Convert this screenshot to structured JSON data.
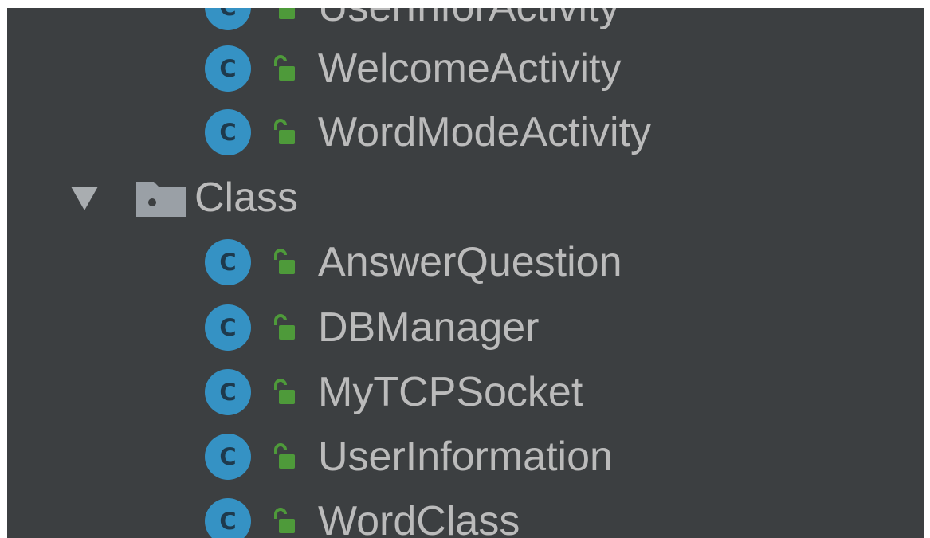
{
  "tree": {
    "top_items": [
      {
        "label": "UserInforActivity",
        "icon": "class-icon",
        "badge": "C",
        "access": "public-lock-icon"
      },
      {
        "label": "WelcomeActivity",
        "icon": "class-icon",
        "badge": "C",
        "access": "public-lock-icon"
      },
      {
        "label": "WordModeActivity",
        "icon": "class-icon",
        "badge": "C",
        "access": "public-lock-icon"
      }
    ],
    "folder": {
      "label": "Class",
      "icon": "package-folder-icon",
      "expanded": true,
      "children": [
        {
          "label": "AnswerQuestion",
          "icon": "class-icon",
          "badge": "C",
          "access": "public-lock-icon"
        },
        {
          "label": "DBManager",
          "icon": "class-icon",
          "badge": "C",
          "access": "public-lock-icon"
        },
        {
          "label": "MyTCPSocket",
          "icon": "class-icon",
          "badge": "C",
          "access": "public-lock-icon"
        },
        {
          "label": "UserInformation",
          "icon": "class-icon",
          "badge": "C",
          "access": "public-lock-icon"
        },
        {
          "label": "WordClass",
          "icon": "class-icon",
          "badge": "C",
          "access": "public-lock-icon"
        }
      ]
    }
  },
  "colors": {
    "background": "#3c3f41",
    "text": "#bbbbbb",
    "class_badge": "#3592c4",
    "lock": "#4e9a3a",
    "folder": "#9aa0a6"
  }
}
